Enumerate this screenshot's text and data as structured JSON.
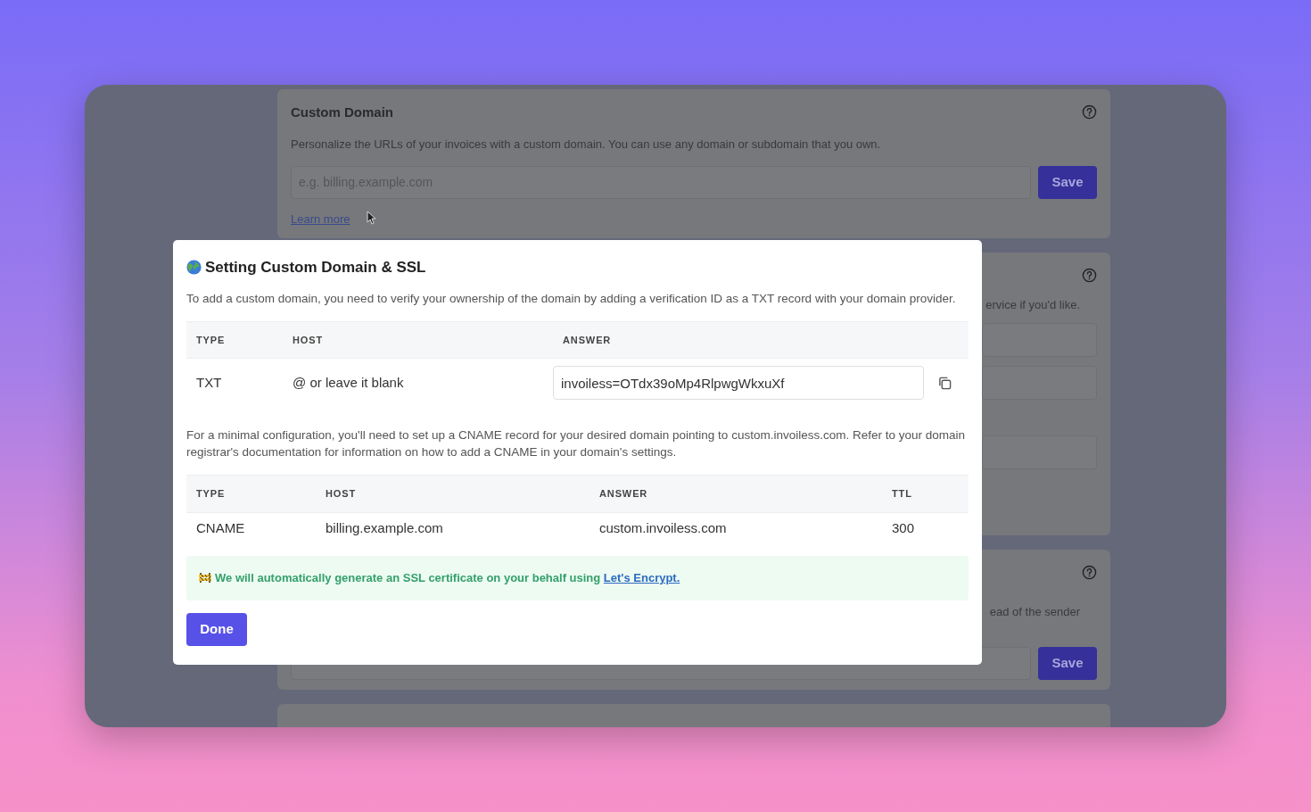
{
  "background": {
    "cards": [
      {
        "title": "Custom Domain",
        "description": "Personalize the URLs of your invoices with a custom domain. You can use any domain or subdomain that you own.",
        "input": {
          "placeholder": "e.g. billing.example.com"
        },
        "button": "Save",
        "link": "Learn more"
      },
      {
        "visible_text": "ervice if you'd like."
      },
      {
        "visible_text": "ead of the sender",
        "button": "Save"
      }
    ]
  },
  "modal": {
    "title": "Setting Custom Domain & SSL",
    "intro": "To add a custom domain, you need to verify your ownership of the domain by adding a verification ID as a TXT record with your domain provider.",
    "txt_table": {
      "columns": [
        "TYPE",
        "HOST",
        "ANSWER"
      ],
      "rows": [
        {
          "type": "TXT",
          "host": "@ or leave it blank",
          "answer": "invoiless=OTdx39oMp4RlpwgWkxuXf"
        }
      ]
    },
    "cname_text": "For a minimal configuration, you'll need to set up a CNAME record for your desired domain pointing to custom.invoiless.com. Refer to your domain registrar's documentation for information on how to add a CNAME in your domain's settings.",
    "cname_table": {
      "columns": [
        "TYPE",
        "HOST",
        "ANSWER",
        "TTL"
      ],
      "rows": [
        {
          "type": "CNAME",
          "host": "billing.example.com",
          "answer": "custom.invoiless.com",
          "ttl": "300"
        }
      ]
    },
    "alert": {
      "text": "We will automatically generate an SSL certificate on your behalf using",
      "link": "Let's Encrypt."
    },
    "button": "Done"
  }
}
